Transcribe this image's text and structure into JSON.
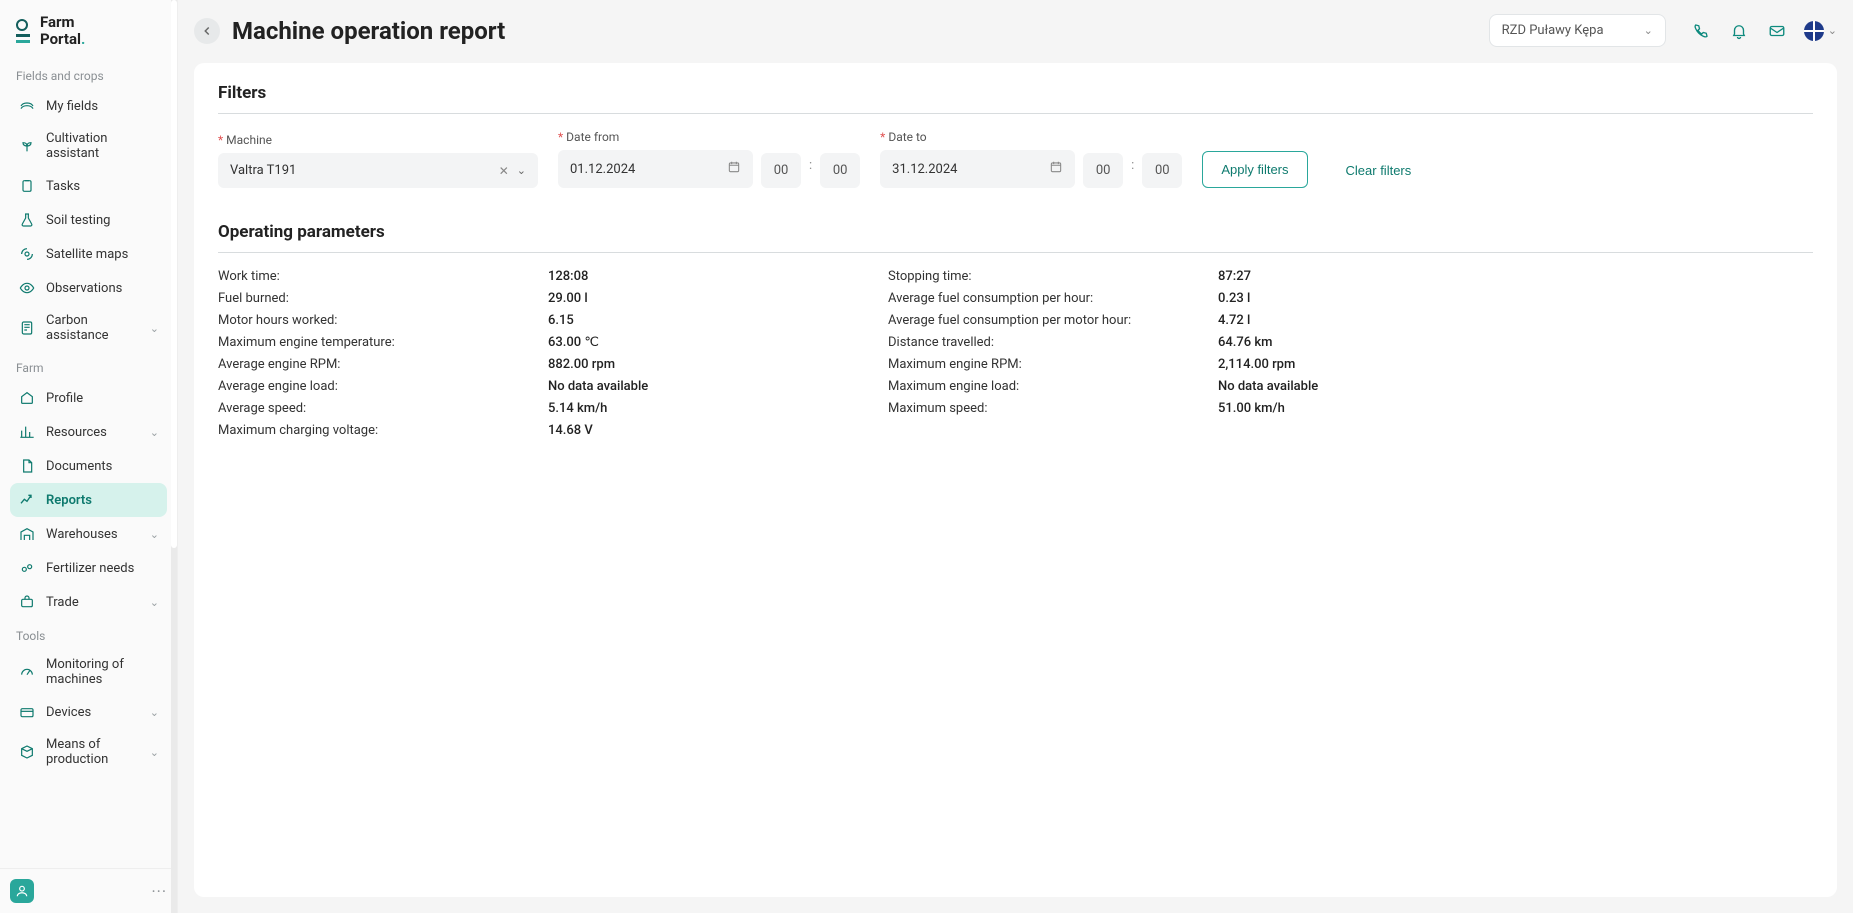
{
  "app": {
    "logo_line1": "Farm",
    "logo_line2": "Portal"
  },
  "sidebar": {
    "sections": {
      "fields_crops_label": "Fields and crops",
      "farm_label": "Farm",
      "tools_label": "Tools"
    },
    "items": {
      "my_fields": "My fields",
      "cultivation_assistant": "Cultivation assistant",
      "tasks": "Tasks",
      "soil_testing": "Soil testing",
      "satellite_maps": "Satellite maps",
      "observations": "Observations",
      "carbon_assistance": "Carbon assistance",
      "profile": "Profile",
      "resources": "Resources",
      "documents": "Documents",
      "reports": "Reports",
      "warehouses": "Warehouses",
      "fertilizer_needs": "Fertilizer needs",
      "trade": "Trade",
      "monitoring_machines": "Monitoring of machines",
      "devices": "Devices",
      "means_of_production": "Means of production"
    }
  },
  "header": {
    "page_title": "Machine operation report",
    "org_selected": "RZD Puławy Kępa"
  },
  "filters": {
    "title": "Filters",
    "machine_label": "Machine",
    "machine_value": "Valtra T191",
    "date_from_label": "Date from",
    "date_from_value": "01.12.2024",
    "date_from_hh": "00",
    "date_from_mm": "00",
    "date_to_label": "Date to",
    "date_to_value": "31.12.2024",
    "date_to_hh": "00",
    "date_to_mm": "00",
    "apply_label": "Apply filters",
    "clear_label": "Clear filters"
  },
  "operating": {
    "title": "Operating parameters",
    "rows": [
      {
        "l1": "Work time:",
        "v1": "128:08",
        "l2": "Stopping time:",
        "v2": "87:27"
      },
      {
        "l1": "Fuel burned:",
        "v1": "29.00 l",
        "l2": "Average fuel consumption per hour:",
        "v2": "0.23 l"
      },
      {
        "l1": "Motor hours worked:",
        "v1": "6.15",
        "l2": "Average fuel consumption per motor hour:",
        "v2": "4.72 l"
      },
      {
        "l1": "Maximum engine temperature:",
        "v1": "63.00 ℃",
        "l2": "Distance travelled:",
        "v2": "64.76 km"
      },
      {
        "l1": "Average engine RPM:",
        "v1": "882.00 rpm",
        "l2": "Maximum engine RPM:",
        "v2": "2,114.00 rpm"
      },
      {
        "l1": "Average engine load:",
        "v1": "No data available",
        "l2": "Maximum engine load:",
        "v2": "No data available"
      },
      {
        "l1": "Average speed:",
        "v1": "5.14 km/h",
        "l2": "Maximum speed:",
        "v2": "51.00 km/h"
      },
      {
        "l1": "Maximum charging voltage:",
        "v1": "14.68 V",
        "l2": "",
        "v2": ""
      }
    ]
  }
}
